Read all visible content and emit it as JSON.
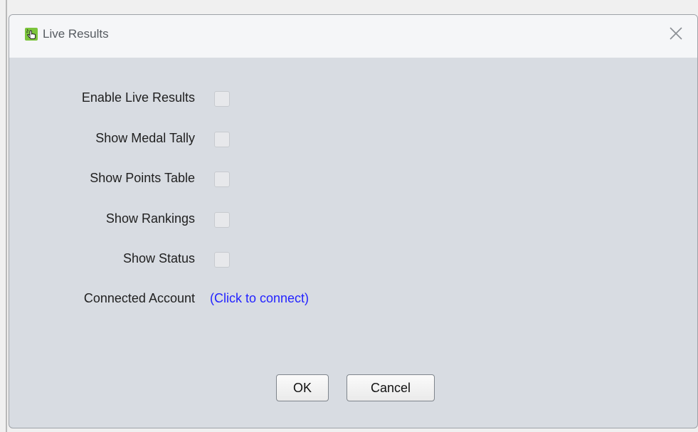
{
  "dialog": {
    "title": "Live Results",
    "icons": {
      "app": "hand-pointer-icon",
      "close": "close-icon"
    },
    "colors": {
      "title_bar": "#f5f6f8",
      "body": "#d8dce2",
      "link": "#2323ff",
      "app_icon": "#7cc43c"
    }
  },
  "options": [
    {
      "label": "Enable Live Results",
      "checked": false
    },
    {
      "label": "Show Medal Tally",
      "checked": false
    },
    {
      "label": "Show Points Table",
      "checked": false
    },
    {
      "label": "Show Rankings",
      "checked": false
    },
    {
      "label": "Show Status",
      "checked": false
    }
  ],
  "account": {
    "label": "Connected Account",
    "link_text": "(Click to connect)"
  },
  "buttons": {
    "ok": "OK",
    "cancel": "Cancel"
  }
}
